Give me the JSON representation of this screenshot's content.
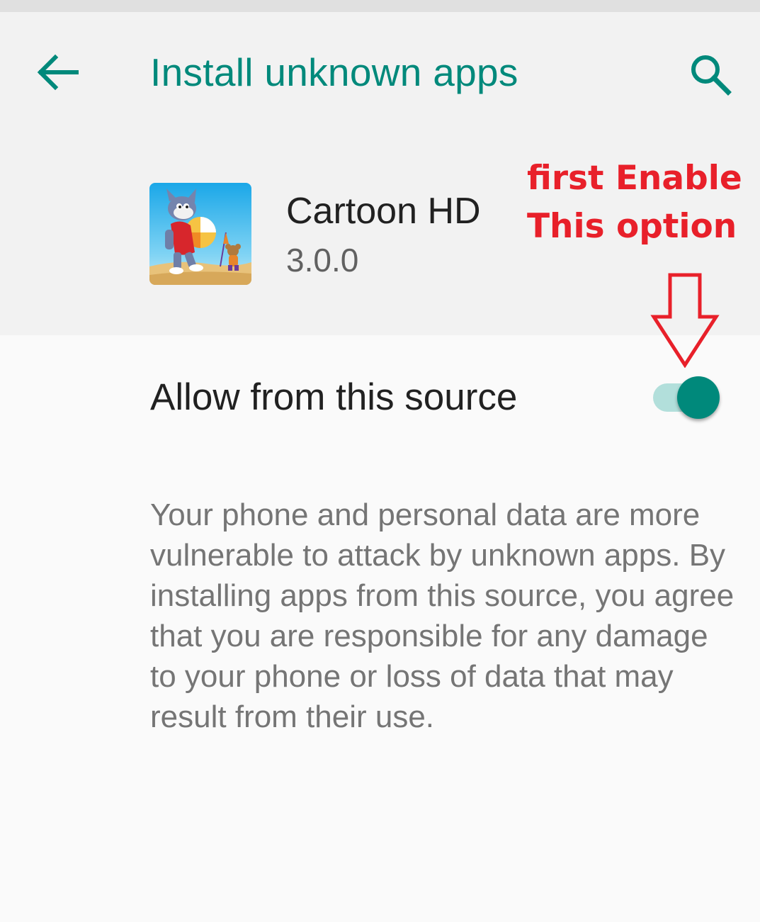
{
  "status_bar": {},
  "app_bar": {
    "title": "Install unknown apps",
    "back_icon": "arrow-left-icon",
    "search_icon": "search-icon"
  },
  "app": {
    "name": "Cartoon HD",
    "version": "3.0.0",
    "icon": "cartoon-app-icon"
  },
  "annotation": {
    "line1": "first Enable",
    "line2": "This option",
    "color": "#e8202a",
    "arrow_icon": "down-arrow-icon"
  },
  "allow": {
    "label": "Allow from this source",
    "enabled": true
  },
  "warning": {
    "text": "Your phone and personal data are more vulnerable to attack by unknown apps. By installing apps from this source, you agree that you are responsible for any damage to your phone or loss of data that may result from their use."
  },
  "colors": {
    "accent": "#00897b",
    "accent_light": "#b2dfdb",
    "header_bg": "#f2f2f2",
    "body_bg": "#fafafa"
  }
}
